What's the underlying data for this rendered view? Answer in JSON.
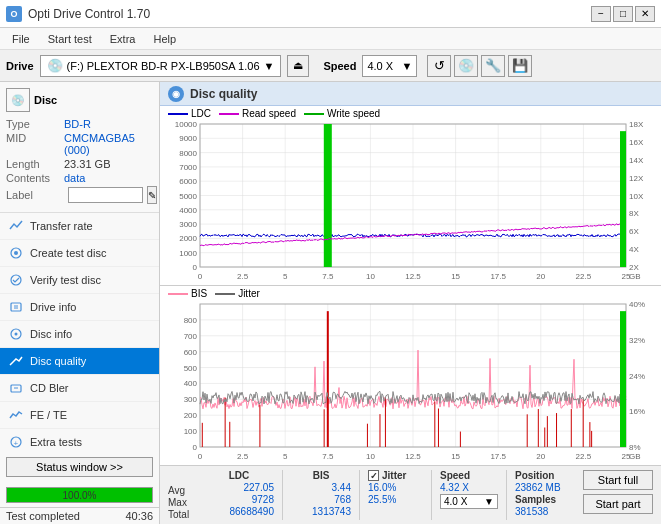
{
  "titlebar": {
    "title": "Opti Drive Control 1.70",
    "icon_label": "O",
    "min_btn": "−",
    "max_btn": "□",
    "close_btn": "✕"
  },
  "menubar": {
    "items": [
      "File",
      "Start test",
      "Extra",
      "Help"
    ]
  },
  "drivebar": {
    "drive_label": "Drive",
    "drive_value": "(F:)  PLEXTOR BD-R  PX-LB950SA 1.06",
    "speed_label": "Speed",
    "speed_value": "4.0 X"
  },
  "disc": {
    "title": "Disc",
    "type_label": "Type",
    "type_value": "BD-R",
    "mid_label": "MID",
    "mid_value": "CMCMAGBA5 (000)",
    "length_label": "Length",
    "length_value": "23.31 GB",
    "contents_label": "Contents",
    "contents_value": "data",
    "label_label": "Label"
  },
  "nav": {
    "items": [
      {
        "id": "transfer-rate",
        "label": "Transfer rate",
        "active": false
      },
      {
        "id": "create-test-disc",
        "label": "Create test disc",
        "active": false
      },
      {
        "id": "verify-test-disc",
        "label": "Verify test disc",
        "active": false
      },
      {
        "id": "drive-info",
        "label": "Drive info",
        "active": false
      },
      {
        "id": "disc-info",
        "label": "Disc info",
        "active": false
      },
      {
        "id": "disc-quality",
        "label": "Disc quality",
        "active": true
      },
      {
        "id": "cd-bler",
        "label": "CD Bler",
        "active": false
      },
      {
        "id": "fe-te",
        "label": "FE / TE",
        "active": false
      },
      {
        "id": "extra-tests",
        "label": "Extra tests",
        "active": false
      }
    ],
    "status_btn": "Status window >>"
  },
  "quality": {
    "title": "Disc quality",
    "legend": {
      "ldc": {
        "label": "LDC",
        "color": "#0000ff"
      },
      "read_speed": {
        "label": "Read speed",
        "color": "#ff00ff"
      },
      "write_speed": {
        "label": "Write speed",
        "color": "#00cc00"
      }
    },
    "legend2": {
      "bis": {
        "label": "BIS",
        "color": "#ff99cc"
      },
      "jitter": {
        "label": "Jitter",
        "color": "#666666"
      }
    }
  },
  "stats": {
    "ldc_header": "LDC",
    "bis_header": "BIS",
    "jitter_header": "Jitter",
    "speed_header": "Speed",
    "position_header": "Position",
    "samples_header": "Samples",
    "avg_label": "Avg",
    "max_label": "Max",
    "total_label": "Total",
    "ldc_avg": "227.05",
    "ldc_max": "9728",
    "ldc_total": "86688490",
    "bis_avg": "3.44",
    "bis_max": "768",
    "bis_total": "1313743",
    "jitter_avg": "16.0%",
    "jitter_max": "25.5%",
    "jitter_total": "",
    "speed_val": "4.32 X",
    "speed_dropdown": "4.0 X",
    "position_val": "23862 MB",
    "samples_val": "381538",
    "start_full": "Start full",
    "start_part": "Start part",
    "jitter_checked": "✓"
  },
  "progress": {
    "value": "100.0%",
    "width_pct": 100
  },
  "statusbar": {
    "text": "Test completed",
    "time": "40:36"
  },
  "colors": {
    "accent": "#0078d7",
    "active_nav": "#0078d7",
    "ldc_line": "#0000cc",
    "read_speed_line": "#cc00cc",
    "write_speed_line": "#00bb00",
    "bis_line": "#ff88aa",
    "jitter_line": "#666666",
    "green_bar": "#00cc00"
  }
}
